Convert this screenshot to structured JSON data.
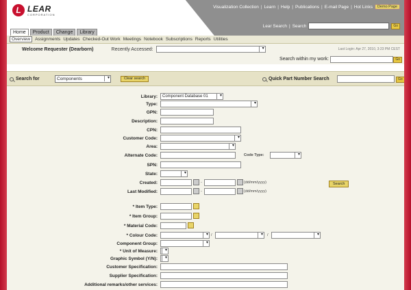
{
  "header": {
    "logo_letter": "L",
    "logo_name": "LEAR",
    "logo_sub": "CORPORATION",
    "links": [
      "Visualization Collection",
      "Learn",
      "Help",
      "Publications",
      "E-mail Page",
      "Hot Links"
    ],
    "demo_label": "Demo Page",
    "search_links": [
      "Lear Search",
      "Search"
    ],
    "go_label": "Go"
  },
  "tabs": [
    {
      "label": "Home",
      "active": true
    },
    {
      "label": "Product",
      "active": false
    },
    {
      "label": "Change",
      "active": false
    },
    {
      "label": "Library",
      "active": false
    }
  ],
  "subnav": [
    "Overview",
    "Assignments",
    "Updates",
    "Checked-Out Work",
    "Meetings",
    "Notebook",
    "Subscriptions",
    "Reports",
    "Utilities"
  ],
  "welcome": "Welcome Requester (Dearborn)",
  "recently_accessed_label": "Recently Accessed:",
  "last_login": "Last Login: Apr 27, 2010, 3:23 PM CEST",
  "search_within_label": "Search within my work:",
  "search_for_label": "Search for",
  "search_for_value": "Components",
  "clear_search_label": "Clear search",
  "quick_part_label": "Quick Part Number Search",
  "search_button_label": "Search",
  "form": {
    "library_label": "Library:",
    "library_value": "Component Database 01",
    "type_label": "Type:",
    "gpn_label": "GPN:",
    "description_label": "Description:",
    "cpn_label": "CPN:",
    "customer_code_label": "Customer Code:",
    "area_label": "Area:",
    "alternate_code_label": "Alternate Code:",
    "code_type_label": "Code Type:",
    "spn_label": "SPN:",
    "state_label": "State:",
    "created_label": "Created:",
    "last_modified_label": "Last Modified:",
    "date_sep": "-",
    "date_hint": "(dd/mm/yyyy)",
    "item_type_label": "* Item Type:",
    "item_group_label": "* Item Group:",
    "material_code_label": "* Material Code:",
    "colour_code_label": "* Colour Code:",
    "colour_sep": "/",
    "component_group_label": "Component Group:",
    "unit_of_measure_label": "* Unit of Measure:",
    "graphic_symbol_label": "Graphic Symbol (Y/N):",
    "customer_spec_label": "Customer Specification:",
    "supplier_spec_label": "Supplier Specification:",
    "additional_remarks_label": "Additional remarks/other services:"
  },
  "colors": {
    "brand_red": "#c8102e",
    "header_grey": "#8f8f8f",
    "button_yellow": "#e8d468",
    "panel_bg": "#f4f3ea"
  }
}
